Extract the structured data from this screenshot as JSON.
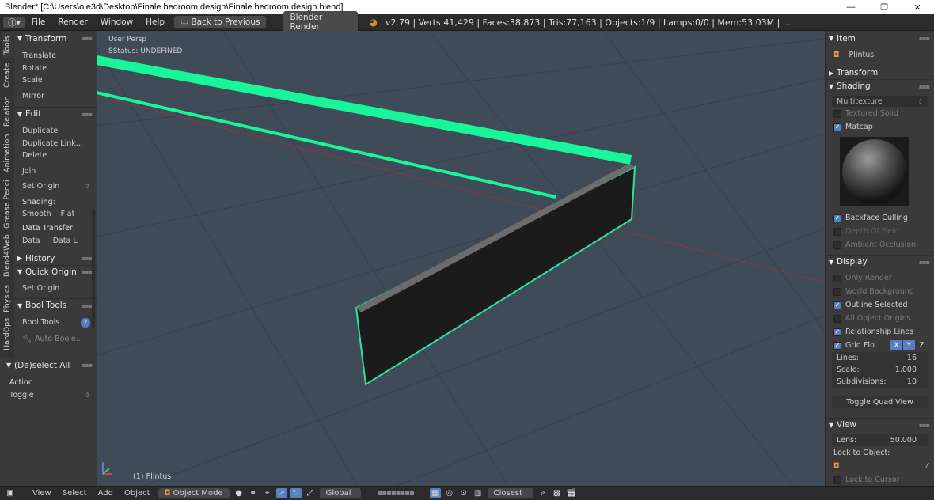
{
  "window": {
    "title": "Blender* [C:\\Users\\ole3d\\Desktop\\Finale bedroom design\\Finale bedroom design.blend]",
    "minimize": "—",
    "maximize": "❐",
    "close": "✕"
  },
  "infobar": {
    "menus": [
      "File",
      "Render",
      "Window",
      "Help"
    ],
    "back_button": "Back to Previous",
    "engine": "Blender Render",
    "stats": "v2.79 | Verts:41,429 | Faces:38,873 | Tris:77,163 | Objects:1/9 | Lamps:0/0 | Mem:53.03M | ..."
  },
  "left_tabs": [
    "Tools",
    "Create",
    "Relation",
    "Animation",
    "Grease Penci",
    "Blend4Web",
    "Physics",
    "HardOps"
  ],
  "toolshelf": {
    "transform": {
      "title": "Transform",
      "items": [
        "Translate",
        "Rotate",
        "Scale",
        "Mirror"
      ]
    },
    "edit": {
      "title": "Edit",
      "items": [
        "Duplicate",
        "Duplicate Link...",
        "Delete",
        "Join",
        "Set Origin"
      ]
    },
    "shading_label": "Shading:",
    "shading_opts": [
      "Smooth",
      "Flat"
    ],
    "data_transfer_label": "Data Transfer:",
    "data_transfer_opts": [
      "Data",
      "Data L"
    ],
    "history": "History",
    "quick_origin": {
      "title": "Quick Origin",
      "items": [
        "Set Origin"
      ]
    },
    "bool_tools": {
      "title": "Bool Tools",
      "items": [
        "Bool Tools",
        "Auto Boole..."
      ]
    }
  },
  "operator": {
    "title": "(De)select All",
    "action_label": "Action",
    "action_value": "Toggle"
  },
  "viewport": {
    "view_name": "User Persp",
    "status": "SStatus: UNDEFINED",
    "object_label": "(1) Plintus",
    "colors": {
      "bg": "#3f4b56",
      "selection": "#19f59a",
      "outline": "#2fe0a0"
    }
  },
  "properties": {
    "item": {
      "title": "Item",
      "object_name": "Plintus"
    },
    "transform_title": "Transform",
    "shading": {
      "title": "Shading",
      "mode": "Multitexture",
      "textured_solid": "Textured Solid",
      "matcap": "Matcap",
      "backface_culling": "Backface Culling",
      "depth_of_field": "Depth Of Field",
      "ambient_occlusion": "Ambient Occlusion"
    },
    "display": {
      "title": "Display",
      "only_render": "Only Render",
      "world_background": "World Background",
      "outline_selected": "Outline Selected",
      "all_object_origins": "All Object Origins",
      "relationship_lines": "Relationship Lines",
      "grid_floor": "Grid Flo",
      "axes": [
        "X",
        "Y",
        "Z"
      ],
      "lines_label": "Lines:",
      "lines_value": "16",
      "scale_label": "Scale:",
      "scale_value": "1.000",
      "subdivisions_label": "Subdivisions:",
      "subdivisions_value": "10",
      "toggle_quad": "Toggle Quad View"
    },
    "view": {
      "title": "View",
      "lens_label": "Lens:",
      "lens_value": "50.000",
      "lock_label": "Lock to Object:",
      "lock_cursor": "Lock to Cursor"
    }
  },
  "footer": {
    "menus": [
      "View",
      "Select",
      "Add",
      "Object"
    ],
    "mode": "Object Mode",
    "orientation": "Global",
    "snap": "Closest"
  }
}
